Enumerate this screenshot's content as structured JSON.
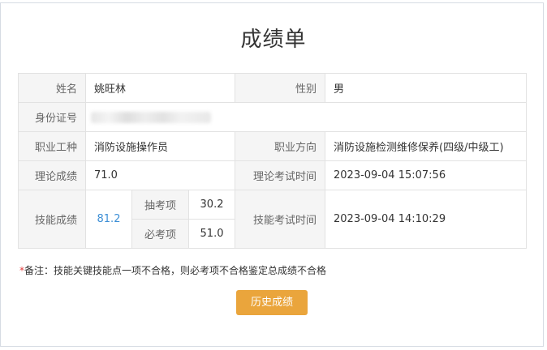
{
  "title": "成绩单",
  "row1": {
    "name_label": "姓名",
    "name_value": "姚旺林",
    "gender_label": "性别",
    "gender_value": "男"
  },
  "row2": {
    "id_label": "身份证号"
  },
  "row3": {
    "job_label": "职业工种",
    "job_value": "消防设施操作员",
    "direction_label": "职业方向",
    "direction_value": "消防设施检测维修保养(四级/中级工)"
  },
  "row4": {
    "theory_label": "理论成绩",
    "theory_value": "71.0",
    "theory_time_label": "理论考试时间",
    "theory_time_value": "2023-09-04 15:07:56"
  },
  "skill": {
    "label": "技能成绩",
    "value": "81.2",
    "draw_label": "抽考项",
    "draw_value": "30.2",
    "required_label": "必考项",
    "required_value": "51.0",
    "time_label": "技能考试时间",
    "time_value": "2023-09-04 14:10:29"
  },
  "note": {
    "star": "*",
    "text": "备注：技能关键技能点一项不合格，则必考项不合格鉴定总成绩不合格"
  },
  "history_button": "历史成绩",
  "colors": {
    "accent_button": "#eaa53c",
    "score_link": "#3d8fd6",
    "note_star": "#e23b3b"
  }
}
